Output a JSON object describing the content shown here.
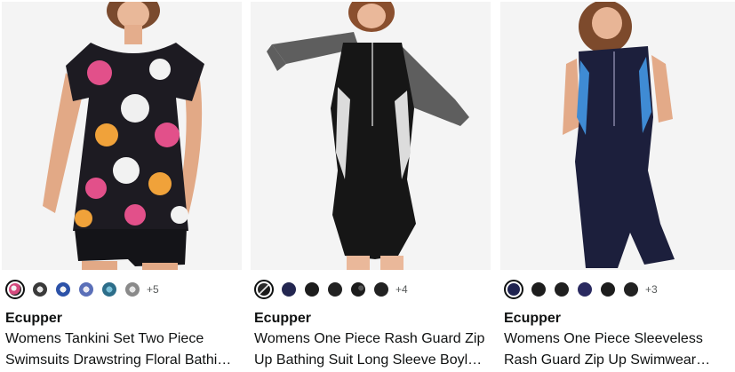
{
  "products": [
    {
      "brand": "Ecupper",
      "title": "Womens Tankini Set Two Piece Swimsuits Drawstring Floral Bathing Suits",
      "more_colors": "+5",
      "swatch_colors": [
        "#d44a7e",
        "#3a3a3a",
        "#2c52a8",
        "#5a6fb8",
        "#2d6e8a",
        "#8a8a8a"
      ],
      "image_icon": "floral-tankini-photo"
    },
    {
      "brand": "Ecupper",
      "title": "Womens One Piece Rash Guard Zip Up Bathing Suit Long Sleeve Boyleg Swimsuit",
      "more_colors": "+4",
      "swatch_colors": [
        "#1a1a1a",
        "#232650",
        "#1d1d1d",
        "#222222",
        "#1c1c1c",
        "#222222"
      ],
      "image_icon": "rash-guard-photo"
    },
    {
      "brand": "Ecupper",
      "title": "Womens One Piece Sleeveless Rash Guard Zip Up Swimwear Bathing Suit",
      "more_colors": "+3",
      "swatch_colors": [
        "#1f2350",
        "#1d1d1d",
        "#202020",
        "#2a2a60",
        "#1d1d1d",
        "#222222"
      ],
      "image_icon": "sleeveless-rash-guard-photo"
    }
  ]
}
